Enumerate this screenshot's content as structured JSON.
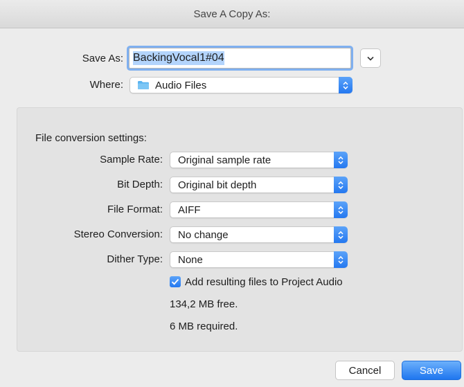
{
  "window": {
    "title": "Save A Copy As:"
  },
  "save_as": {
    "label": "Save As:",
    "value": "BackingVocal1#04",
    "expand_icon": "chevron-down-icon"
  },
  "where": {
    "label": "Where:",
    "value": "Audio Files",
    "icon": "folder-icon"
  },
  "conversion": {
    "heading": "File conversion settings:",
    "sample_rate": {
      "label": "Sample Rate:",
      "value": "Original sample rate"
    },
    "bit_depth": {
      "label": "Bit Depth:",
      "value": "Original bit depth"
    },
    "file_format": {
      "label": "File Format:",
      "value": "AIFF"
    },
    "stereo_conversion": {
      "label": "Stereo Conversion:",
      "value": "No change"
    },
    "dither_type": {
      "label": "Dither Type:",
      "value": "None"
    },
    "add_to_project": {
      "label": "Add resulting files to Project Audio",
      "checked": true
    },
    "free_space": "134,2 MB free.",
    "required_space": "6 MB required."
  },
  "buttons": {
    "cancel": "Cancel",
    "save": "Save"
  },
  "colors": {
    "accent": "#2a7ef2",
    "selection": "#b3d4fc",
    "folder": "#5ab4f0"
  }
}
